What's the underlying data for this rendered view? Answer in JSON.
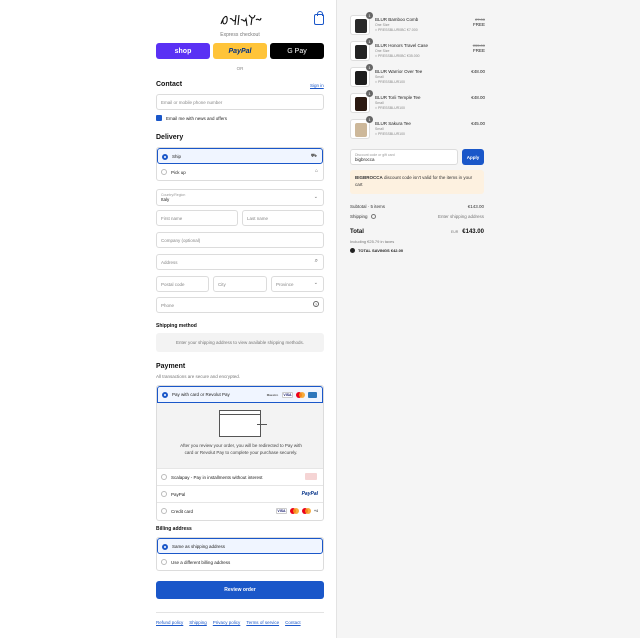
{
  "header": {
    "logo_alt": "Daddy Naxos"
  },
  "express": {
    "title": "Express checkout",
    "shop": "shop",
    "paypal": "PayPal",
    "gpay": "G Pay",
    "or": "OR"
  },
  "contact": {
    "heading": "Contact",
    "sign_in": "Sign in",
    "email_placeholder": "Email or mobile phone number",
    "newsletter": "Email me with news and offers"
  },
  "delivery": {
    "heading": "Delivery",
    "options": [
      {
        "label": "Ship",
        "selected": true
      },
      {
        "label": "Pick up",
        "selected": false
      }
    ],
    "country_label": "Country/Region",
    "country_value": "Italy",
    "first_name": "First name",
    "last_name": "Last name",
    "company": "Company (optional)",
    "address": "Address",
    "postal": "Postal code",
    "city": "City",
    "province": "Province",
    "phone": "Phone"
  },
  "shipping": {
    "heading": "Shipping method",
    "placeholder": "Enter your shipping address to view available shipping methods."
  },
  "payment": {
    "heading": "Payment",
    "subtitle": "All transactions are secure and encrypted.",
    "methods": [
      {
        "label": "Pay with card or Revolut Pay",
        "selected": true
      },
      {
        "label": "Scalapay - Pay in installments without interest",
        "selected": false
      },
      {
        "label": "PayPal",
        "selected": false
      },
      {
        "label": "Credit card",
        "selected": false
      }
    ],
    "redirect_text": "After you review your order, you will be redirected to Pay with card or Revolut Pay to complete your purchase securely.",
    "card_marks": {
      "maestro": "Maestro",
      "visa": "VISA",
      "more": "+4"
    },
    "paypal_mark": "PayPal"
  },
  "billing": {
    "heading": "Billing address",
    "options": [
      {
        "label": "Same as shipping address",
        "selected": true
      },
      {
        "label": "Use a different billing address",
        "selected": false
      }
    ]
  },
  "review_button": "Review order",
  "footer_links": [
    "Refund policy",
    "Shipping",
    "Privacy policy",
    "Terms of service",
    "Contact"
  ],
  "cart": {
    "items": [
      {
        "qty": "1",
        "name": "BLUR Bamboo Comb",
        "variant": "One Size",
        "code": "PRESSBLUR0BC €7.000",
        "price": "FREE",
        "old_price": "€7.00",
        "thumb": "#2a2a2a"
      },
      {
        "qty": "1",
        "name": "BLUR Honors Travel Case",
        "variant": "One Size",
        "code": "PRESSBLUR0BC €35.000",
        "price": "FREE",
        "old_price": "€35.00",
        "thumb": "#222"
      },
      {
        "qty": "1",
        "name": "BLUR Warrior Over Tee",
        "variant": "Small",
        "code": "PRESSBLUR100",
        "price": "€48.00",
        "old_price": "",
        "thumb": "#1d1d1d"
      },
      {
        "qty": "1",
        "name": "BLUR Torii Temple Tee",
        "variant": "Small",
        "code": "PRESSBLUR100",
        "price": "€48.00",
        "old_price": "",
        "thumb": "#2b1a12"
      },
      {
        "qty": "1",
        "name": "BLUR Sakura Tee",
        "variant": "Small",
        "code": "PRESSBLUR100",
        "price": "€45.00",
        "old_price": "",
        "thumb": "#cdb89a"
      }
    ],
    "discount_label": "Discount code or gift card",
    "discount_value": "bigbrocca",
    "apply": "Apply",
    "error_code": "BIGBROCCA",
    "error_text": "discount code isn't valid for the items in your cart",
    "subtotal_label": "Subtotal · 5 items",
    "subtotal_value": "€143.00",
    "shipping_label": "Shipping",
    "shipping_value": "Enter shipping address",
    "total_label": "Total",
    "currency": "EUR",
    "total_value": "€143.00",
    "taxes": "Including €25.79 in taxes",
    "savings_label": "TOTAL SAVINGS",
    "savings_value": "€42.00"
  }
}
